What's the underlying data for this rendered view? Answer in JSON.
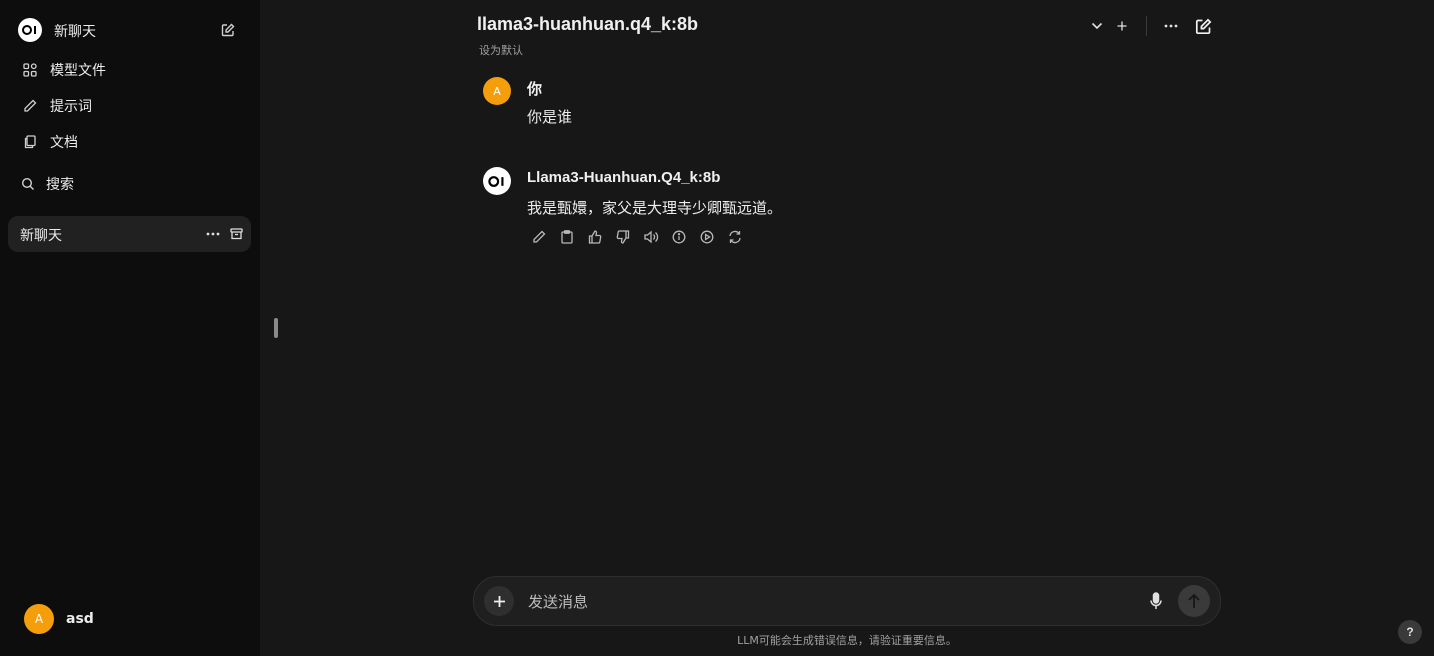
{
  "sidebar": {
    "brand_label": "新聊天",
    "nav": [
      {
        "label": "模型文件",
        "icon": "grid-icon"
      },
      {
        "label": "提示词",
        "icon": "pencil-icon"
      },
      {
        "label": "文档",
        "icon": "documents-icon"
      },
      {
        "label": "搜索",
        "icon": "search-icon"
      }
    ],
    "chats": [
      {
        "title": "新聊天",
        "active": true
      }
    ],
    "user": {
      "initial": "A",
      "name": "asd"
    }
  },
  "header": {
    "model_title": "llama3-huanhuan.q4_k:8b",
    "set_default_label": "设为默认"
  },
  "messages": [
    {
      "role": "user",
      "avatar_initial": "A",
      "name": "你",
      "text": "你是谁"
    },
    {
      "role": "assistant",
      "name": "Llama3-Huanhuan.Q4_k:8b",
      "text": "我是甄嬛，家父是大理寺少卿甄远道。"
    }
  ],
  "input": {
    "placeholder": "发送消息",
    "value": ""
  },
  "disclaimer": "LLM可能会生成错误信息，请验证重要信息。",
  "help_label": "?",
  "colors": {
    "accent_avatar": "#f59e0b",
    "sidebar_bg": "#0d0d0d",
    "main_bg": "#171717"
  }
}
